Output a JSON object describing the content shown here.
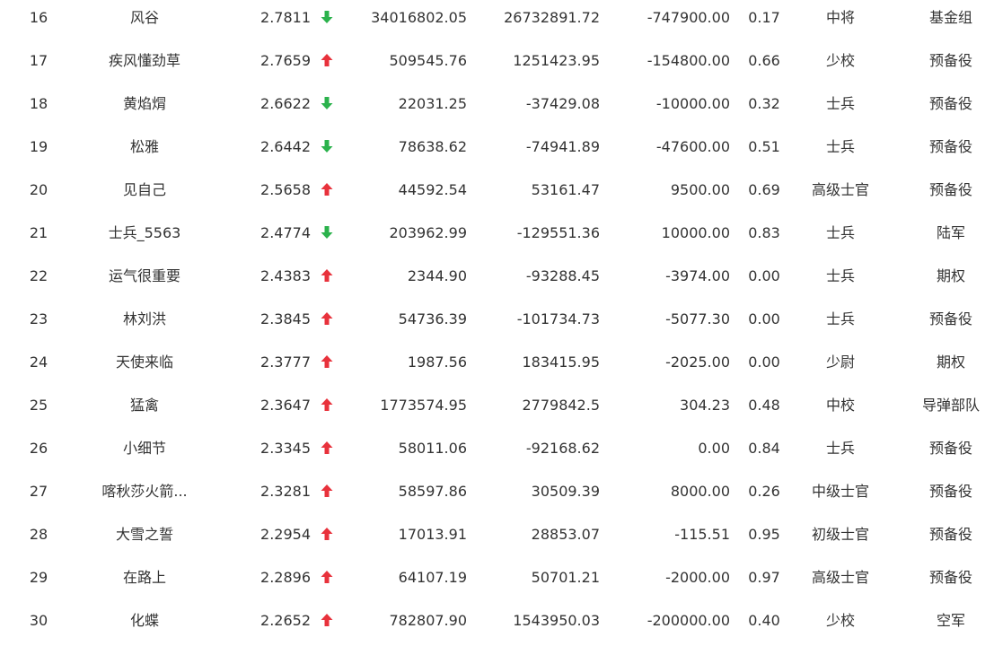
{
  "colors": {
    "text": "#333333",
    "up": "#e8323c",
    "down": "#2bb24c",
    "background": "#ffffff"
  },
  "rows": [
    {
      "rank": "16",
      "name": "风谷",
      "score": "2.7811",
      "trend": "down",
      "value1": "34016802.05",
      "value2": "26732891.72",
      "value3": "-747900.00",
      "ratio": "0.17",
      "level": "中将",
      "group": "基金组"
    },
    {
      "rank": "17",
      "name": "疾风懂劲草",
      "score": "2.7659",
      "trend": "up",
      "value1": "509545.76",
      "value2": "1251423.95",
      "value3": "-154800.00",
      "ratio": "0.66",
      "level": "少校",
      "group": "预备役"
    },
    {
      "rank": "18",
      "name": "黄焰焨",
      "score": "2.6622",
      "trend": "down",
      "value1": "22031.25",
      "value2": "-37429.08",
      "value3": "-10000.00",
      "ratio": "0.32",
      "level": "士兵",
      "group": "预备役"
    },
    {
      "rank": "19",
      "name": "松雅",
      "score": "2.6442",
      "trend": "down",
      "value1": "78638.62",
      "value2": "-74941.89",
      "value3": "-47600.00",
      "ratio": "0.51",
      "level": "士兵",
      "group": "预备役"
    },
    {
      "rank": "20",
      "name": "见自己",
      "score": "2.5658",
      "trend": "up",
      "value1": "44592.54",
      "value2": "53161.47",
      "value3": "9500.00",
      "ratio": "0.69",
      "level": "高级士官",
      "group": "预备役"
    },
    {
      "rank": "21",
      "name": "士兵_5563",
      "score": "2.4774",
      "trend": "down",
      "value1": "203962.99",
      "value2": "-129551.36",
      "value3": "10000.00",
      "ratio": "0.83",
      "level": "士兵",
      "group": "陆军"
    },
    {
      "rank": "22",
      "name": "运气很重要",
      "score": "2.4383",
      "trend": "up",
      "value1": "2344.90",
      "value2": "-93288.45",
      "value3": "-3974.00",
      "ratio": "0.00",
      "level": "士兵",
      "group": "期权"
    },
    {
      "rank": "23",
      "name": "林刘洪",
      "score": "2.3845",
      "trend": "up",
      "value1": "54736.39",
      "value2": "-101734.73",
      "value3": "-5077.30",
      "ratio": "0.00",
      "level": "士兵",
      "group": "预备役"
    },
    {
      "rank": "24",
      "name": "天使来临",
      "score": "2.3777",
      "trend": "up",
      "value1": "1987.56",
      "value2": "183415.95",
      "value3": "-2025.00",
      "ratio": "0.00",
      "level": "少尉",
      "group": "期权"
    },
    {
      "rank": "25",
      "name": "猛禽",
      "score": "2.3647",
      "trend": "up",
      "value1": "1773574.95",
      "value2": "2779842.5",
      "value3": "304.23",
      "ratio": "0.48",
      "level": "中校",
      "group": "导弹部队"
    },
    {
      "rank": "26",
      "name": "小细节",
      "score": "2.3345",
      "trend": "up",
      "value1": "58011.06",
      "value2": "-92168.62",
      "value3": "0.00",
      "ratio": "0.84",
      "level": "士兵",
      "group": "预备役"
    },
    {
      "rank": "27",
      "name": "喀秋莎火箭...",
      "score": "2.3281",
      "trend": "up",
      "value1": "58597.86",
      "value2": "30509.39",
      "value3": "8000.00",
      "ratio": "0.26",
      "level": "中级士官",
      "group": "预备役"
    },
    {
      "rank": "28",
      "name": "大雪之誓",
      "score": "2.2954",
      "trend": "up",
      "value1": "17013.91",
      "value2": "28853.07",
      "value3": "-115.51",
      "ratio": "0.95",
      "level": "初级士官",
      "group": "预备役"
    },
    {
      "rank": "29",
      "name": "在路上",
      "score": "2.2896",
      "trend": "up",
      "value1": "64107.19",
      "value2": "50701.21",
      "value3": "-2000.00",
      "ratio": "0.97",
      "level": "高级士官",
      "group": "预备役"
    },
    {
      "rank": "30",
      "name": "化蝶",
      "score": "2.2652",
      "trend": "up",
      "value1": "782807.90",
      "value2": "1543950.03",
      "value3": "-200000.00",
      "ratio": "0.40",
      "level": "少校",
      "group": "空军"
    }
  ]
}
